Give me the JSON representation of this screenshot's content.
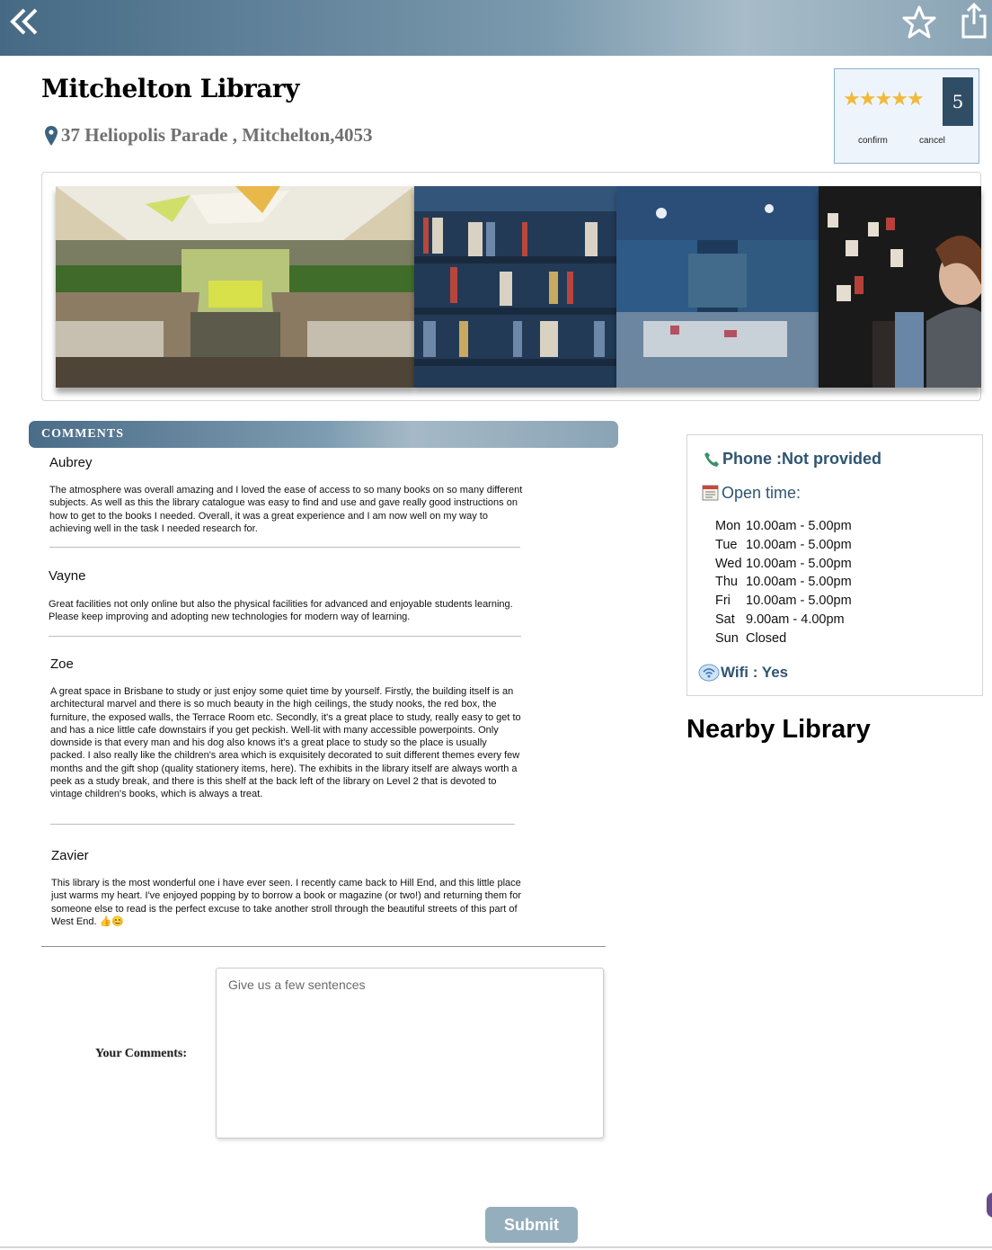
{
  "header": {
    "back_icon": "double-chevron-left-icon",
    "favorite_icon": "star-outline-icon",
    "share_icon": "share-icon"
  },
  "library": {
    "name": "Mitchelton Library",
    "address": "37 Heliopolis Parade , Mitchelton,4053"
  },
  "rating": {
    "stars": 5,
    "value": "5",
    "confirm_label": "confirm",
    "cancel_label": "cancel",
    "star_color": "#f1b93a"
  },
  "gallery": {
    "photos": [
      "library-atrium-photo",
      "bookshelves-photo",
      "bookshop-interior-photo",
      "bookseller-photo"
    ]
  },
  "comments": {
    "header": "COMMENTS",
    "items": [
      {
        "name": "Aubrey",
        "text": "The atmosphere was overall amazing and I loved the ease of access to so many books on so many different subjects. As well as this the library catalogue was easy to find and use and gave really good instructions on how to get to the books I needed. Overall, it was a great experience and I am now well on my way to achieving well in the task I needed research for."
      },
      {
        "name": "Vayne",
        "text": "Great facilities not only online but also the physical facilities for advanced and enjoyable students learning. Please keep improving and adopting new technologies for modern way of learning."
      },
      {
        "name": "Zoe",
        "text": "A great space in Brisbane to study or just enjoy some quiet time by yourself. Firstly, the building itself is an architectural marvel and there is so much beauty in the high ceilings, the study nooks, the red box, the furniture, the exposed walls, the Terrace Room etc. Secondly, it's a great place to study, really easy to get to and has a nice little cafe downstairs if you get peckish. Well-lit with many accessible powerpoints. Only downside is that every man and his dog also knows it's a great place to study so the place is usually packed. I also really like the children's area which is exquisitely decorated to suit different themes every few months and the gift shop (quality stationery items, here). The exhibits in the library itself are always worth a peek as a study break, and there is this shelf at the back left of the library on Level 2 that is devoted to vintage children's books, which is always a treat."
      },
      {
        "name": "Zavier",
        "text": "This library is the most wonderful one i have ever seen. I recently came back to Hill End, and this little place just warms my heart. I've enjoyed popping by to borrow a book or magazine (or two!) and returning them for someone else to read is the perfect excuse to take another stroll through the beautiful streets of this part of West End. 👍😊"
      }
    ]
  },
  "info": {
    "phone": "Phone :Not provided",
    "open_time_label": "Open time:",
    "hours": [
      {
        "day": "Mon",
        "time": "10.00am - 5.00pm"
      },
      {
        "day": "Tue",
        "time": "10.00am - 5.00pm"
      },
      {
        "day": "Wed",
        "time": "10.00am - 5.00pm"
      },
      {
        "day": "Thu",
        "time": "10.00am - 5.00pm"
      },
      {
        "day": "Fri",
        "time": "10.00am - 5.00pm"
      },
      {
        "day": "Sat",
        "time": "9.00am - 4.00pm"
      },
      {
        "day": "Sun",
        "time": "Closed"
      }
    ],
    "wifi": "Wifi : Yes"
  },
  "nearby": {
    "title": "Nearby Library"
  },
  "form": {
    "label": "Your Comments:",
    "placeholder": "Give us a few sentences",
    "submit_label": "Submit"
  }
}
